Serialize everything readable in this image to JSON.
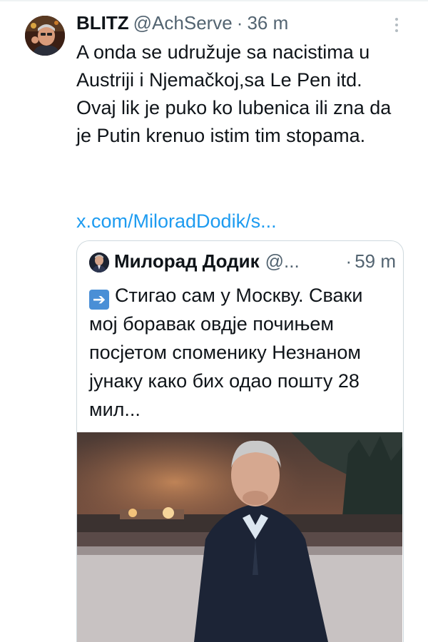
{
  "tweet": {
    "display_name": "BLITZ",
    "handle": "@AchServe",
    "separator": "·",
    "time": "36 m",
    "text": "A onda se udružuje sa nacistima u Austriji i Njemačkoj,sa Le Pen itd. Ovaj lik je puko ko lubenica ili zna da je Putin krenuo istim tim stopama.",
    "link": "x.com/MiloradDodik/s..."
  },
  "quoted_tweet": {
    "display_name": "Милорад Додик",
    "handle": "@...",
    "separator": "·",
    "time": "59 m",
    "emoji": "arrow-right-emoji",
    "text": "Стигао сам у Москву. Сваки мој боравак овдје почињем посјетом споменику Незнаном јунаку како бих одао пошту 28 мил..."
  },
  "icons": {
    "avatar": "profile-photo",
    "more": "more-options-icon",
    "quoted_avatar": "profile-photo",
    "media": "video-thumbnail"
  },
  "colors": {
    "text": "#0f1419",
    "secondary": "#536471",
    "link": "#1d9bf0",
    "border": "#cfd9de"
  }
}
